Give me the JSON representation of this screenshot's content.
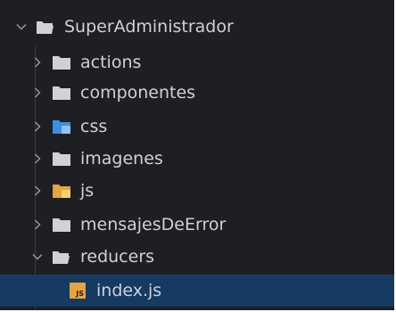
{
  "tree": {
    "root": {
      "label": "SuperAdministrador",
      "icon": "folder-open-icon",
      "expanded": true
    },
    "items": [
      {
        "label": "actions",
        "icon": "folder-icon",
        "expanded": false
      },
      {
        "label": "componentes",
        "icon": "folder-icon",
        "expanded": false
      },
      {
        "label": "css",
        "icon": "css-folder-icon",
        "expanded": false
      },
      {
        "label": "imagenes",
        "icon": "folder-icon",
        "expanded": false
      },
      {
        "label": "js",
        "icon": "js-folder-icon",
        "expanded": false
      },
      {
        "label": "mensajesDeError",
        "icon": "folder-icon",
        "expanded": false
      },
      {
        "label": "reducers",
        "icon": "folder-open-icon",
        "expanded": true
      }
    ],
    "children": [
      {
        "label": "index.js",
        "icon": "js-file-icon",
        "badge": "JS",
        "selected": true
      }
    ]
  },
  "colors": {
    "background": "#1e1f22",
    "text": "#cfd1d4",
    "folder": "#cfd1d4",
    "css_folder": "#3d8fe0",
    "js_folder": "#e8a33b",
    "selection": "#153b63"
  }
}
